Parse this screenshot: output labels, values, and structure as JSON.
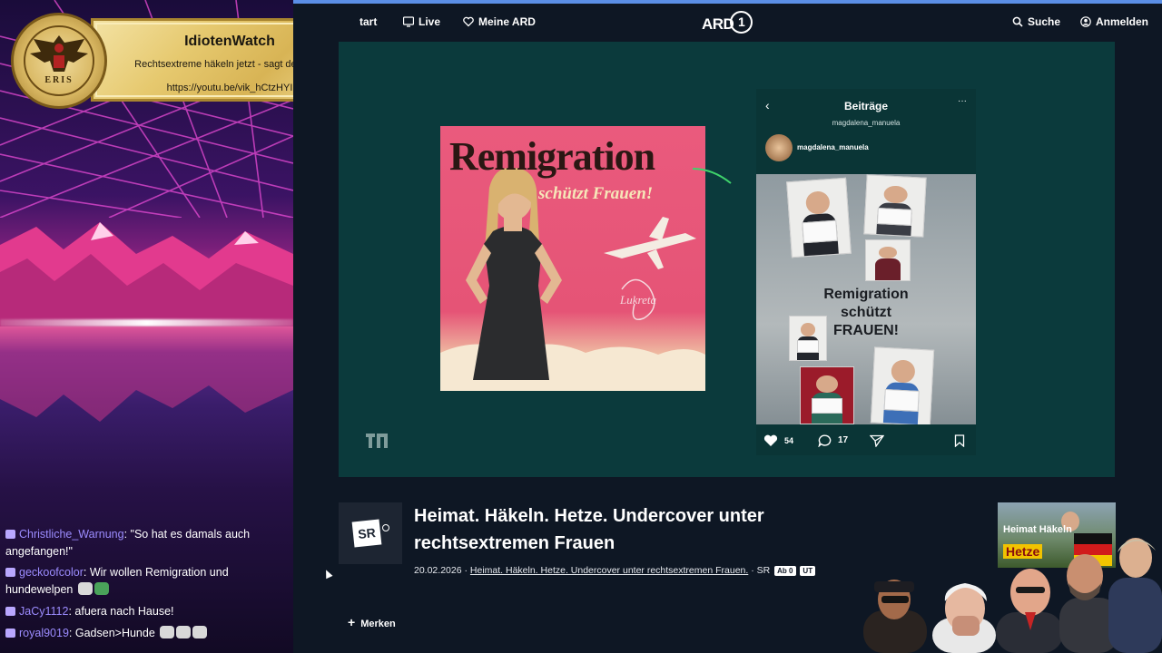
{
  "overlay": {
    "badge": {
      "title": "IdiotenWatch",
      "subtitle": "Rechtsextreme häkeln jetzt - sagt der ÖRR",
      "url": "https://youtu.be/vik_hCtzHYI",
      "seal_text": "ERIS"
    },
    "chat": [
      {
        "user": "Christliche_Warnung",
        "text": "\"So hat es damals auch angefangen!\""
      },
      {
        "user": "geckoofcolor",
        "text": "Wir wollen Remigration und hundewelpen"
      },
      {
        "user": "JaCy1112",
        "text": "afuera nach Hause!"
      },
      {
        "user": "royal9019",
        "text": "Gadsen>Hunde"
      }
    ]
  },
  "nav": {
    "start": "tart",
    "live": "Live",
    "meine_ard": "Meine ARD",
    "logo": "ARD",
    "logo_num": "1",
    "search": "Suche",
    "login": "Anmelden"
  },
  "hero": {
    "poster": {
      "title": "Remigration",
      "subtitle": "schützt Frauen!",
      "signature": "Lukreta"
    },
    "instagram": {
      "title": "Beiträge",
      "account": "magdalena_manuela",
      "user": "magdalena_manuela",
      "post_text_1": "Remigration",
      "post_text_2": "schützt",
      "post_text_3": "FRAUEN!",
      "likes": "54",
      "comments": "17"
    }
  },
  "video": {
    "channel": "SR",
    "title": "Heimat. Häkeln. Hetze. Undercover unter rechtsextremen Frauen",
    "date": "20.02.2026",
    "series_link": "Heimat. Häkeln. Hetze. Undercover unter rechtsextremen Frauen.",
    "broadcaster": "SR",
    "tag_ab": "Ab 0",
    "tag_ut": "UT",
    "merken": "Merken",
    "thumb_text": "Heimat Häkeln",
    "thumb_hetze": "Hetze"
  },
  "colors": {
    "accent": "#5b8fe6",
    "hero_bg": "#0b3a3c",
    "page_bg": "#0e1724",
    "poster_pink": "#e55476",
    "badge_gold": "#e6c96f"
  }
}
